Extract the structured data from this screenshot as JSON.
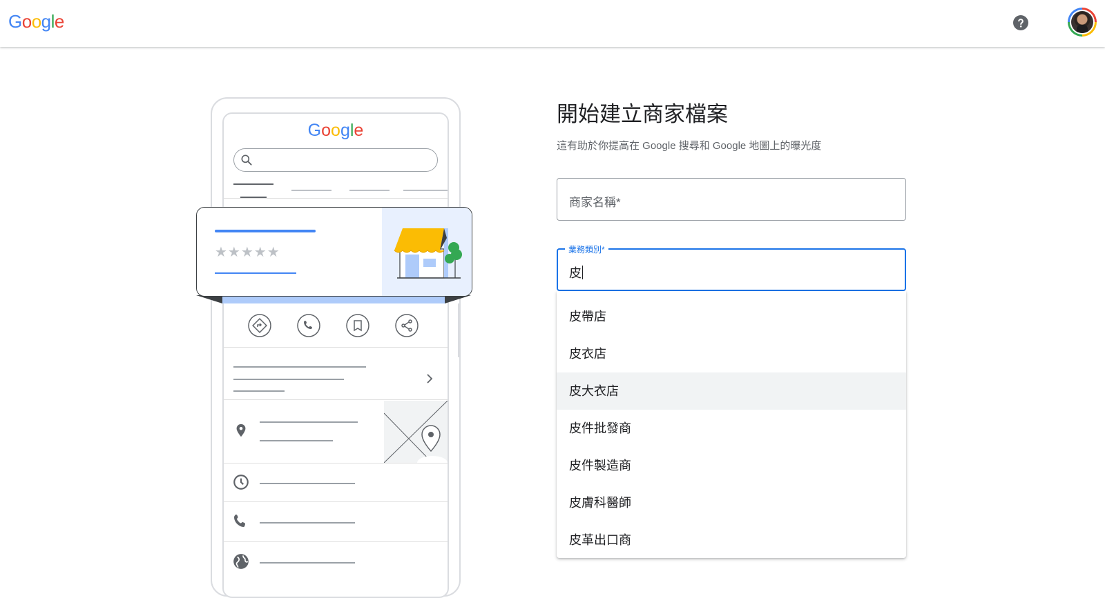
{
  "header": {
    "logo_letters": [
      {
        "ch": "G",
        "color": "#4285f4"
      },
      {
        "ch": "o",
        "color": "#ea4335"
      },
      {
        "ch": "o",
        "color": "#fbbc04"
      },
      {
        "ch": "g",
        "color": "#4285f4"
      },
      {
        "ch": "l",
        "color": "#34a853"
      },
      {
        "ch": "e",
        "color": "#ea4335"
      }
    ],
    "help_icon": "help-circle-icon",
    "avatar_icon": "user-avatar"
  },
  "illustration": {
    "logo_text": "Google",
    "stars": "★★★★★"
  },
  "form": {
    "title": "開始建立商家檔案",
    "subtitle": "這有助於你提高在 Google 搜尋和 Google 地圖上的曝光度",
    "business_name": {
      "placeholder": "商家名稱*",
      "value": ""
    },
    "category": {
      "label": "業務類別*",
      "value": "皮"
    },
    "suggestions": [
      "皮帶店",
      "皮衣店",
      "皮大衣店",
      "皮件批發商",
      "皮件製造商",
      "皮膚科醫師",
      "皮革出口商"
    ],
    "highlighted_index": 2
  },
  "colors": {
    "accent": "#1a73e8",
    "awning": "#fbbc04",
    "card_blue": "#4285f4"
  }
}
